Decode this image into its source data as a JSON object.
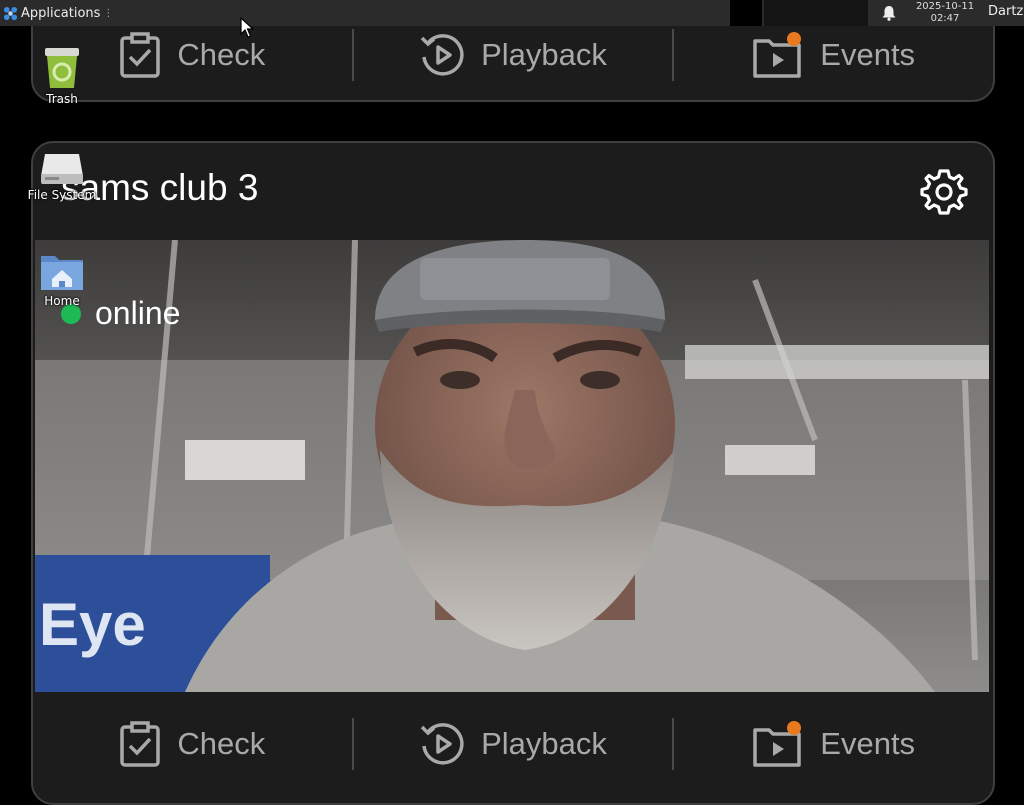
{
  "panel": {
    "applications_label": "Applications",
    "date": "2025-10-11",
    "time": "02:47",
    "user": "Dartz"
  },
  "desktop": {
    "trash_label": "Trash",
    "filesystem_label": "File System",
    "home_label": "Home"
  },
  "camera": {
    "name": "sams club 3",
    "status": "online",
    "status_color": "#1db954"
  },
  "actions": {
    "check": "Check",
    "playback": "Playback",
    "events": "Events"
  },
  "video_overlay": {
    "store_sign": "Eye"
  },
  "colors": {
    "card_bg": "#1c1c1c",
    "card_border": "#3f3f3f",
    "event_badge": "#e8791e",
    "action_text": "#a9a9a9"
  }
}
